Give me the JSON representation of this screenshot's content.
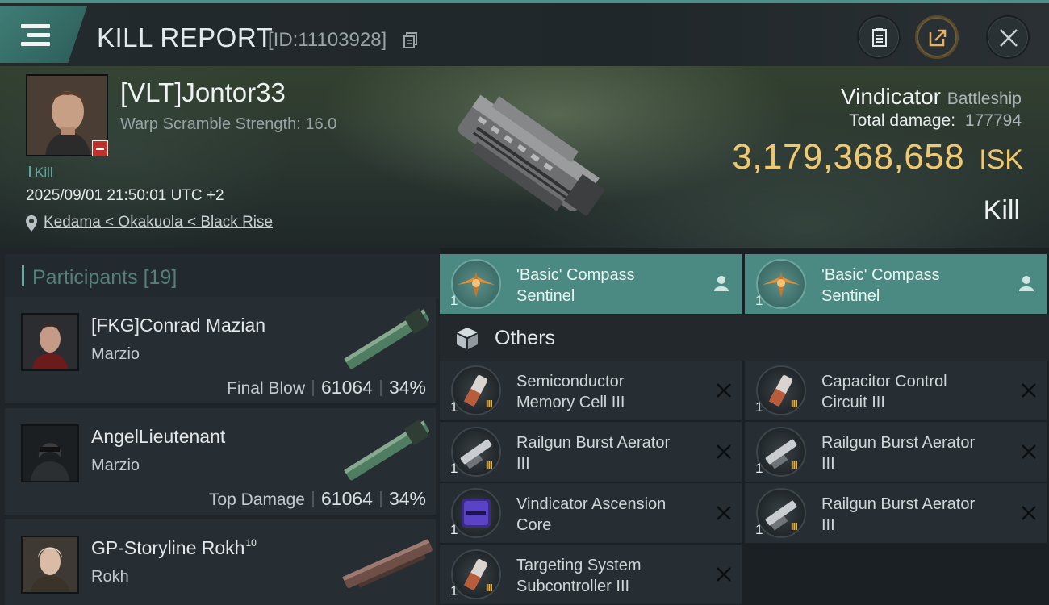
{
  "header": {
    "title": "KILL REPORT",
    "report_id": "[ID:11103928]"
  },
  "victim": {
    "name": "[VLT]Jontor33",
    "warp_scramble": "Warp Scramble Strength: 16.0",
    "tag": "Kill",
    "datetime": "2025/09/01 21:50:01 UTC +2",
    "location": "Kedama < Okakuola < Black Rise",
    "ship_name": "Vindicator",
    "ship_class": "Battleship",
    "damage_label": "Total damage:",
    "damage_value": "177794",
    "isk_value": "3,179,368,658",
    "isk_unit": "ISK",
    "result": "Kill"
  },
  "participants": {
    "label": "Participants",
    "count": "[19]",
    "rows": [
      {
        "name": "[FKG]Conrad Mazian",
        "sup": "",
        "ship": "Marzio",
        "stat_label": "Final Blow",
        "damage": "61064",
        "percent": "34%"
      },
      {
        "name": "AngelLieutenant",
        "sup": "",
        "ship": "Marzio",
        "stat_label": "Top Damage",
        "damage": "61064",
        "percent": "34%"
      },
      {
        "name": "GP-Storyline Rokh",
        "sup": "10",
        "ship": "Rokh",
        "stat_label": "",
        "damage": "",
        "percent": ""
      }
    ]
  },
  "items": {
    "drones": [
      {
        "name_1": "'Basic' Compass",
        "name_2": "Sentinel",
        "qty": "1"
      },
      {
        "name_1": "'Basic' Compass",
        "name_2": "Sentinel",
        "qty": "1"
      }
    ],
    "others_label": "Others",
    "others": [
      {
        "name_1": "Semiconductor",
        "name_2": "Memory Cell III",
        "qty": "1",
        "tier": "III",
        "icon": "canister-icon"
      },
      {
        "name_1": "Capacitor Control",
        "name_2": "Circuit III",
        "qty": "1",
        "tier": "III",
        "icon": "canister-icon"
      },
      {
        "name_1": "Railgun Burst Aerator",
        "name_2": "III",
        "qty": "1",
        "tier": "III",
        "icon": "railgun-rig-icon"
      },
      {
        "name_1": "Railgun Burst Aerator",
        "name_2": "III",
        "qty": "1",
        "tier": "III",
        "icon": "railgun-rig-icon"
      },
      {
        "name_1": "Vindicator Ascension",
        "name_2": "Core",
        "qty": "1",
        "tier": "",
        "icon": "ascension-core-icon"
      },
      {
        "name_1": "Railgun Burst Aerator",
        "name_2": "III",
        "qty": "1",
        "tier": "III",
        "icon": "railgun-rig-icon"
      },
      {
        "name_1": "Targeting System",
        "name_2": "Subcontroller III",
        "qty": "1",
        "tier": "III",
        "icon": "canister-icon"
      }
    ]
  }
}
